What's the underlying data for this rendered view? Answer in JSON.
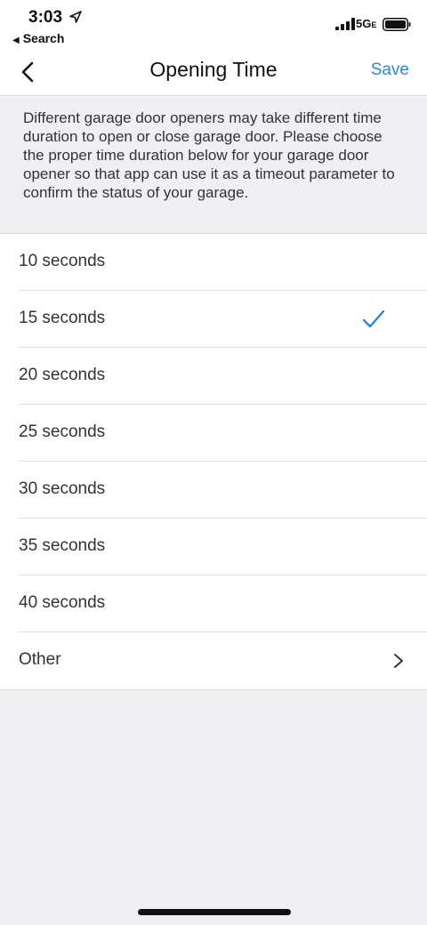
{
  "status_bar": {
    "time": "3:03",
    "back_app": "Search",
    "network": "5G",
    "network_suffix": "E",
    "icons": [
      "location-arrow-icon",
      "signal-icon",
      "battery-icon"
    ]
  },
  "nav": {
    "title": "Opening Time",
    "save_label": "Save",
    "back_icon": "chevron-left-icon",
    "accent": "#2d86d1"
  },
  "description": "Different garage door openers may take different time duration to open or close garage door. Please choose the proper time duration below for your garage door opener so that app can use it as a timeout parameter to confirm the status of your garage.",
  "options": [
    {
      "label": "10 seconds",
      "selected": false
    },
    {
      "label": "15 seconds",
      "selected": true
    },
    {
      "label": "20 seconds",
      "selected": false
    },
    {
      "label": "25 seconds",
      "selected": false
    },
    {
      "label": "30 seconds",
      "selected": false
    },
    {
      "label": "35 seconds",
      "selected": false
    },
    {
      "label": "40 seconds",
      "selected": false
    },
    {
      "label": "Other",
      "selected": false,
      "has_chevron": true
    }
  ]
}
